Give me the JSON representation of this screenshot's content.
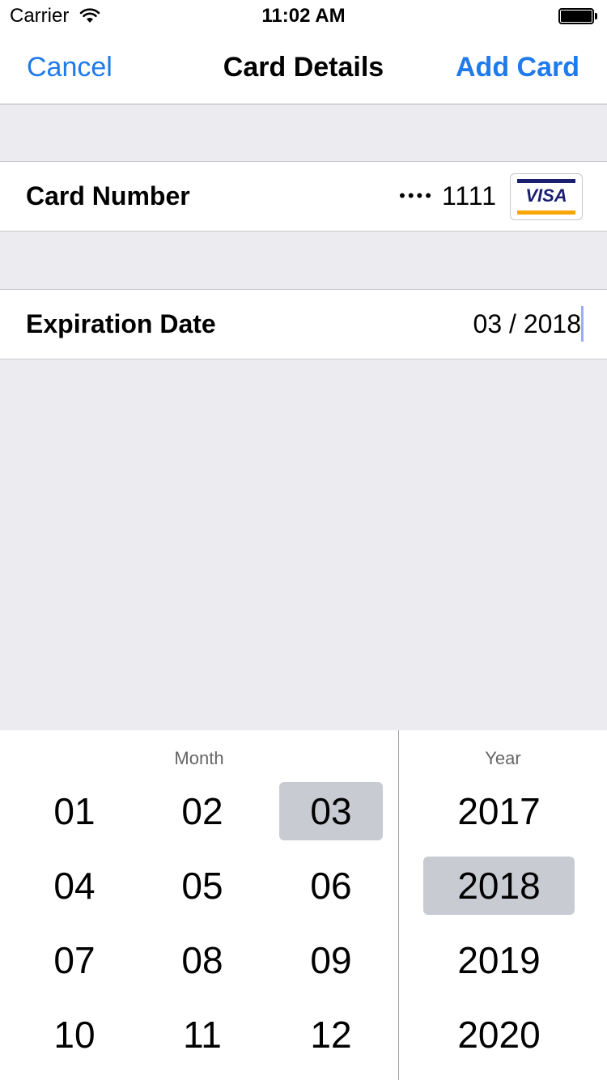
{
  "status_bar": {
    "carrier": "Carrier",
    "time": "11:02 AM"
  },
  "nav": {
    "cancel": "Cancel",
    "title": "Card Details",
    "add_card": "Add Card"
  },
  "card_row": {
    "label": "Card Number",
    "masked_dots": "••••",
    "last_four": "1111",
    "brand": "VISA"
  },
  "exp_row": {
    "label": "Expiration Date",
    "value": "03 / 2018"
  },
  "picker": {
    "month_header": "Month",
    "year_header": "Year",
    "months": [
      "01",
      "02",
      "03",
      "04",
      "05",
      "06",
      "07",
      "08",
      "09",
      "10",
      "11",
      "12"
    ],
    "selected_month": "03",
    "years": [
      "2017",
      "2018",
      "2019",
      "2020"
    ],
    "selected_year": "2018"
  },
  "colors": {
    "accent": "#1f7aeb",
    "background": "#ebebf0",
    "selected_cell": "#c8cbd2",
    "visa_blue": "#1a1f71",
    "visa_gold": "#f7a600"
  }
}
